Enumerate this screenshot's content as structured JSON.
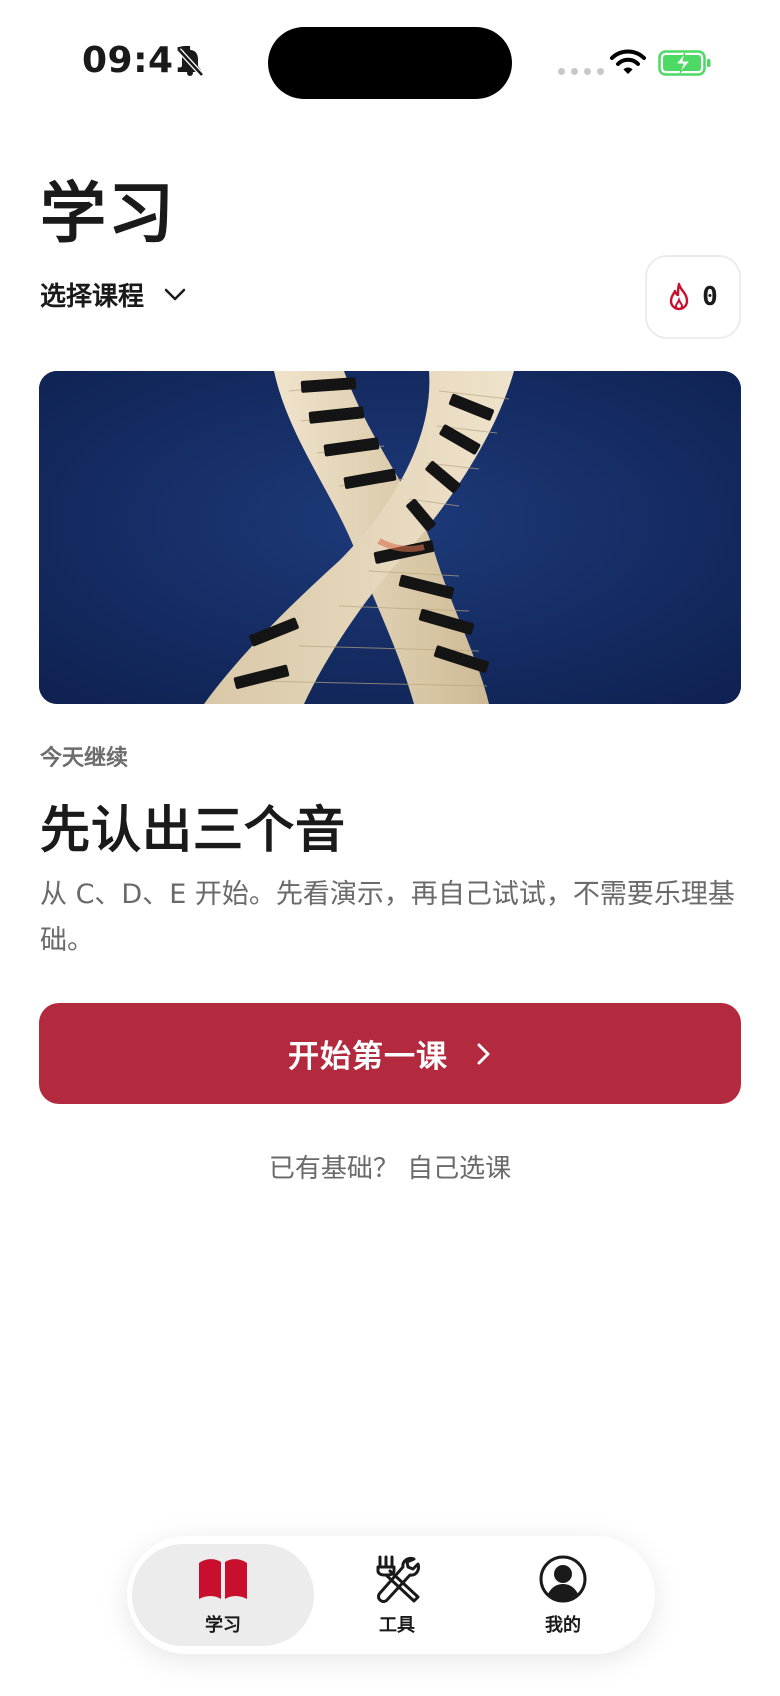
{
  "status_bar": {
    "time": "09:41",
    "icons": [
      "bell-slash-icon",
      "signal-dots-icon",
      "wifi-icon",
      "battery-charging-icon"
    ],
    "battery_color": "#4cd964"
  },
  "header": {
    "title": "学习",
    "course_select_label": "选择课程",
    "streak_count": "0",
    "streak_icon": "flame-icon"
  },
  "hero": {
    "image_subject": "piano-keyboard-helix"
  },
  "lesson": {
    "eyebrow": "今天继续",
    "title": "先认出三个音",
    "description": "从 C、D、E 开始。先看演示，再自己试试，不需要乐理基础。",
    "start_button_label": "开始第一课",
    "self_select_link": "已有基础？ 自己选课"
  },
  "tab_bar": {
    "tabs": [
      {
        "label": "学习",
        "icon": "book-icon",
        "active": true
      },
      {
        "label": "工具",
        "icon": "tools-icon",
        "active": false
      },
      {
        "label": "我的",
        "icon": "user-circle-icon",
        "active": false
      }
    ]
  },
  "colors": {
    "accent": "#b32a3f",
    "active_tab_icon": "#c8102e",
    "hero_background": "#14295e"
  }
}
